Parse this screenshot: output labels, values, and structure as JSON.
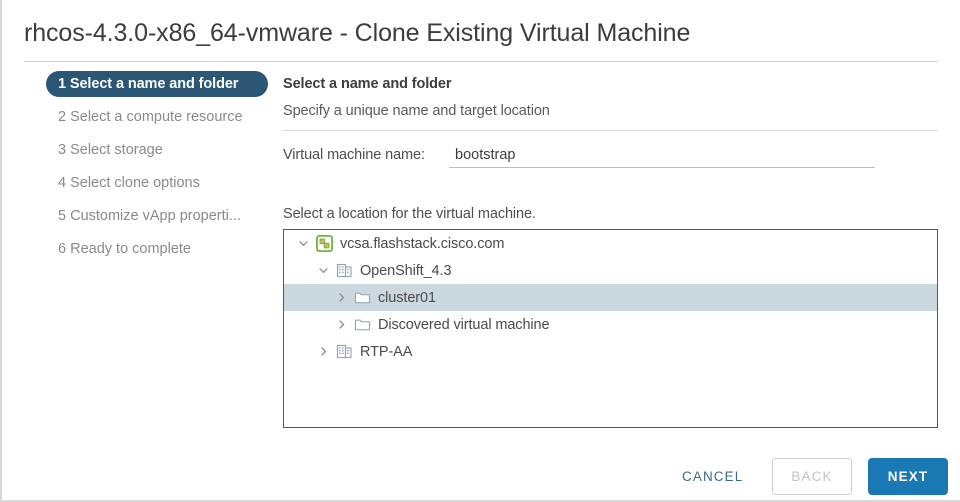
{
  "window": {
    "title": "rhcos-4.3.0-x86_64-vmware - Clone Existing Virtual Machine"
  },
  "steps": [
    {
      "label": "1 Select a name and folder",
      "active": true
    },
    {
      "label": "2 Select a compute resource",
      "active": false
    },
    {
      "label": "3 Select storage",
      "active": false
    },
    {
      "label": "4 Select clone options",
      "active": false
    },
    {
      "label": "5 Customize vApp properti...",
      "active": false
    },
    {
      "label": "6 Ready to complete",
      "active": false
    }
  ],
  "section": {
    "title": "Select a name and folder",
    "subtitle": "Specify a unique name and target location"
  },
  "form": {
    "name_label": "Virtual machine name:",
    "name_value": "bootstrap",
    "name_placeholder": ""
  },
  "location": {
    "label": "Select a location for the virtual machine.",
    "tree": [
      {
        "label": "vcsa.flashstack.cisco.com",
        "icon": "vcenter-icon",
        "twisty": "expanded",
        "indent": 0,
        "selected": false
      },
      {
        "label": "OpenShift_4.3",
        "icon": "datacenter-icon",
        "twisty": "expanded",
        "indent": 1,
        "selected": false
      },
      {
        "label": "cluster01",
        "icon": "folder-icon",
        "twisty": "collapsed",
        "indent": 2,
        "selected": true
      },
      {
        "label": "Discovered virtual machine",
        "icon": "folder-icon",
        "twisty": "collapsed",
        "indent": 2,
        "selected": false
      },
      {
        "label": "RTP-AA",
        "icon": "datacenter-icon",
        "twisty": "collapsed",
        "indent": 1,
        "selected": false
      }
    ]
  },
  "footer": {
    "cancel_label": "CANCEL",
    "back_label": "BACK",
    "next_label": "NEXT"
  },
  "colors": {
    "active_step_bg": "#2b5675",
    "primary_button_bg": "#1a79b5",
    "selected_row_bg": "#ccd8df",
    "vcenter_icon_green": "#6cb33f",
    "vcenter_icon_accent": "#e8b05c",
    "link_text": "#3d6a86"
  }
}
